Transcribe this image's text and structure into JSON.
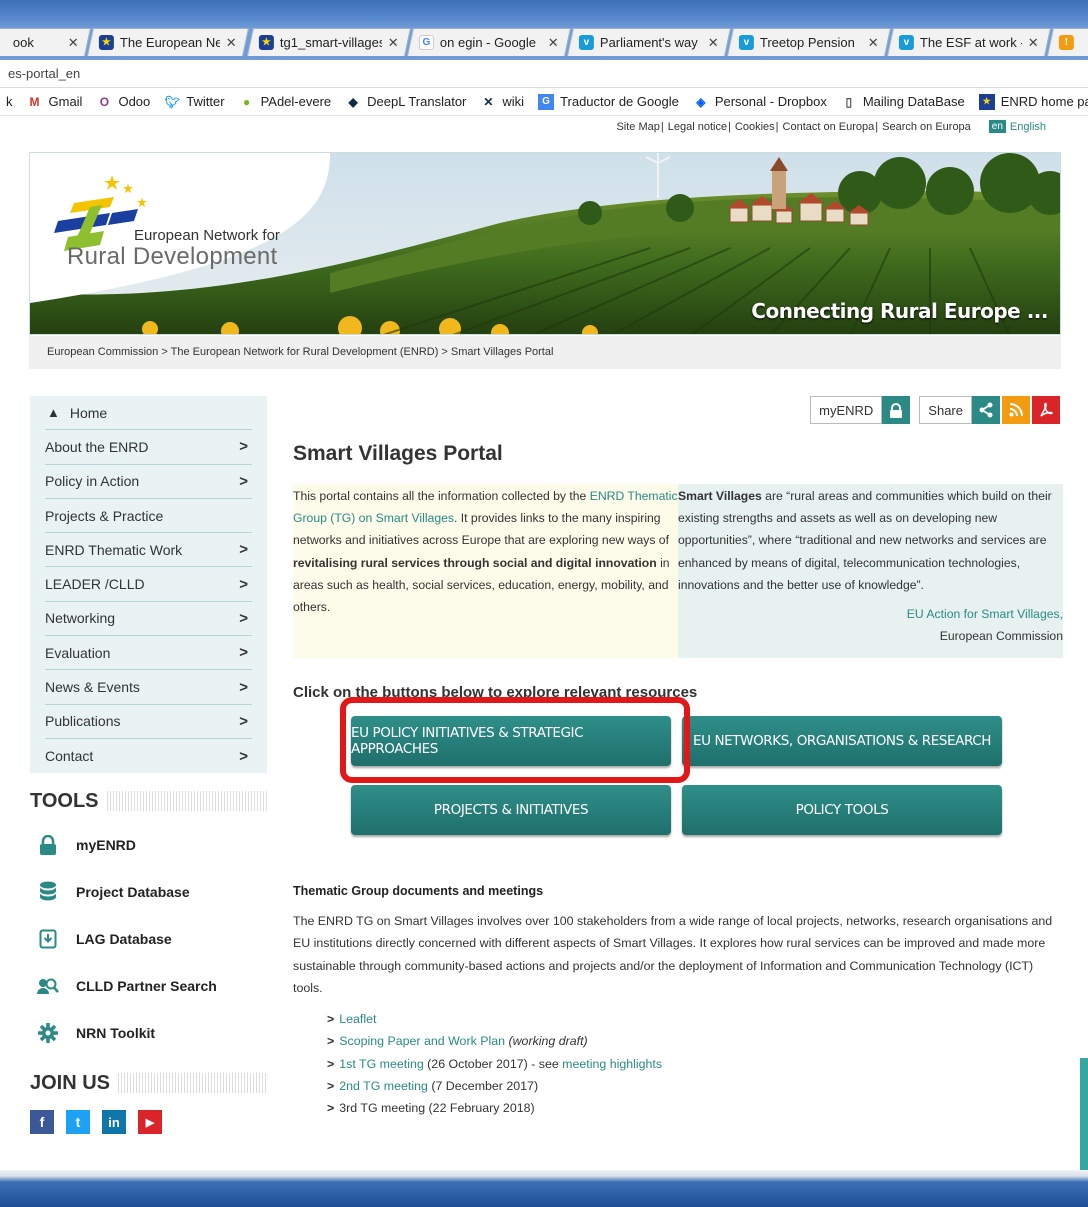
{
  "browser": {
    "tabs": [
      {
        "label": "ook",
        "icon_color": "",
        "icon_char": ""
      },
      {
        "label": "The European Net",
        "icon_color": "#1c3f95",
        "icon_char": "★"
      },
      {
        "label": "tg1_smart-villages",
        "icon_color": "#1c3f95",
        "icon_char": "★"
      },
      {
        "label": "on egin - Google",
        "icon_color": "#4285f4",
        "icon_char": "G"
      },
      {
        "label": "Parliament's way",
        "icon_color": "#1a9ad6",
        "icon_char": "v"
      },
      {
        "label": "Treetop Pension",
        "icon_color": "#1a9ad6",
        "icon_char": "v"
      },
      {
        "label": "The ESF at work -",
        "icon_color": "#1a9ad6",
        "icon_char": "v"
      }
    ],
    "url_fragment": "es-portal_en",
    "bookmarks": [
      {
        "label": "k",
        "icon": ""
      },
      {
        "label": "Gmail",
        "icon": "M"
      },
      {
        "label": "Odoo",
        "icon": "O"
      },
      {
        "label": "Twitter",
        "icon": "t"
      },
      {
        "label": "PAdel-evere",
        "icon": "P"
      },
      {
        "label": "DeepL Translator",
        "icon": "D"
      },
      {
        "label": "wiki",
        "icon": "X"
      },
      {
        "label": "Traductor de Google",
        "icon": "G"
      },
      {
        "label": "Personal - Dropbox",
        "icon": "◆"
      },
      {
        "label": "Mailing DataBase",
        "icon": "□"
      },
      {
        "label": "ENRD home page - E",
        "icon": "★"
      }
    ]
  },
  "top_links": {
    "items": [
      "Site Map",
      "Legal notice",
      "Cookies",
      "Contact on Europa",
      "Search on Europa"
    ],
    "lang_code": "en",
    "lang_name": "English"
  },
  "banner": {
    "logo_line1": "European Network for",
    "logo_line2": "Rural Development",
    "tagline": "Connecting Rural Europe ..."
  },
  "breadcrumb": "European Commission > The European Network for Rural Development (ENRD) > Smart Villages Portal",
  "sidebar": {
    "home": "Home",
    "items": [
      {
        "label": "About the ENRD",
        "chevron": true
      },
      {
        "label": "Policy in Action",
        "chevron": true
      },
      {
        "label": "Projects & Practice",
        "chevron": false
      },
      {
        "label": "ENRD Thematic Work",
        "chevron": true
      },
      {
        "label": "LEADER /CLLD",
        "chevron": true
      },
      {
        "label": "Networking",
        "chevron": true
      },
      {
        "label": "Evaluation",
        "chevron": true
      },
      {
        "label": "News & Events",
        "chevron": true
      },
      {
        "label": "Publications",
        "chevron": true
      },
      {
        "label": "Contact",
        "chevron": true
      }
    ],
    "chevron": ">"
  },
  "tools": {
    "heading": "TOOLS",
    "items": [
      "myENRD",
      "Project Database",
      "LAG Database",
      "CLLD Partner Search",
      "NRN Toolkit"
    ]
  },
  "join": {
    "heading": "JOIN US",
    "networks": [
      {
        "name": "facebook",
        "glyph": "f",
        "color": "#3b5998"
      },
      {
        "name": "twitter",
        "glyph": "t",
        "color": "#1da1f2"
      },
      {
        "name": "linkedin",
        "glyph": "in",
        "color": "#0e76a8"
      },
      {
        "name": "youtube",
        "glyph": "▶",
        "color": "#d9252a"
      }
    ]
  },
  "actions": {
    "myenrd": "myENRD",
    "share": "Share"
  },
  "main": {
    "title": "Smart Villages Portal",
    "intro_left": {
      "p1": "This portal contains all the information collected by the ",
      "link1": "ENRD Thematic Group (TG) on Smart Villages",
      "p2": ". It provides links to the many inspiring networks and initiatives across Europe that are exploring new ways of ",
      "bold": "revitalising rural services through social and digital innovation",
      "p3": " in areas such as health, social services, education, energy, mobility, and others."
    },
    "intro_right": {
      "bold": "Smart Villages",
      "text": " are “rural areas and communities which build on their existing strengths and assets as well as on developing new opportunities”, where “traditional and new networks and services are enhanced by means of digital, telecommunication technologies, innovations and the better use of knowledge”.",
      "cite_link": "EU Action for Smart Villages,",
      "cite_org": "European Commission"
    },
    "explore_label": "Click on the buttons below to explore relevant resources",
    "buttons": [
      "EU POLICY INITIATIVES & STRATEGIC APPROACHES",
      "EU NETWORKS, ORGANISATIONS & RESEARCH",
      "PROJECTS & INITIATIVES",
      "POLICY TOOLS"
    ],
    "tg_heading": "Thematic Group documents and meetings",
    "tg_text": "The ENRD TG on Smart Villages involves over 100 stakeholders from a wide range of local projects, networks, research organisations and EU institutions directly concerned with different aspects of Smart Villages. It explores how rural services can be improved and made more sustainable through community-based actions and projects and/or the deployment of Information and Communication Technology (ICT) tools.",
    "links": [
      {
        "link": "Leaflet",
        "after": "",
        "after_italic": "",
        "after_link": ""
      },
      {
        "link": "Scoping Paper and Work Plan",
        "after": " ",
        "after_italic": "(working draft)",
        "after_link": ""
      },
      {
        "link": "1st TG meeting",
        "after": " (26 October 2017) - see ",
        "after_italic": "",
        "after_link": "meeting highlights"
      },
      {
        "link": "2nd TG meeting",
        "after": " (7 December 2017)",
        "after_italic": "",
        "after_link": ""
      },
      {
        "link": "",
        "after": "3rd TG meeting (22 February 2018)",
        "after_italic": "",
        "after_link": ""
      }
    ]
  },
  "colors": {
    "accent": "#2b8a86",
    "highlight_box": "#e21818"
  }
}
